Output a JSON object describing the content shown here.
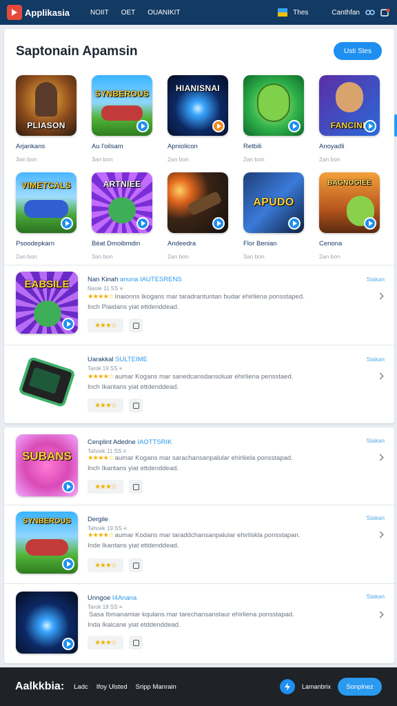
{
  "header": {
    "brand": "Applikasia",
    "nav": [
      "NOIIT",
      "OET",
      "OUANIKIT"
    ],
    "right_label_1": "Thes",
    "right_label_2": "Canthfan"
  },
  "section": {
    "title": "Saptonain Apamsin",
    "see_all_label": "Usti Stes"
  },
  "grid_items": [
    {
      "art_label": "PLIASON",
      "name": "Arjankans",
      "sub": "3an bon",
      "icon": "robot-hero-art"
    },
    {
      "art_label": "SYNBEROUS",
      "name": "Au l'oilsam",
      "sub": "3an bon",
      "icon": "team-battle-art"
    },
    {
      "art_label": "HIANISNAI",
      "name": "Apniolicon",
      "sub": "2an bon",
      "icon": "energy-orb-art"
    },
    {
      "art_label": "",
      "name": "Retbili",
      "sub": "2an bon",
      "icon": "green-ogre-art"
    },
    {
      "art_label": "FANCINE",
      "name": "Anoyadli",
      "sub": "2an bon",
      "icon": "hero-portraits-art"
    },
    {
      "art_label": "VIMETCALS",
      "name": "Psoodepkarn",
      "sub": "2an bon",
      "icon": "crowd-battle-art"
    },
    {
      "art_label": "ARTNIEE",
      "name": "Bèat Dmoibmdin",
      "sub": "3an bon",
      "icon": "purple-creature-art"
    },
    {
      "art_label": "",
      "name": "Andeedra",
      "sub": "2an bon",
      "icon": "cannon-fire-art"
    },
    {
      "art_label": "APUDO",
      "name": "Flor Benian",
      "sub": "3an bon",
      "icon": "mech-blaster-art"
    },
    {
      "art_label": "BAGNOGIEE",
      "name": "Cenona",
      "sub": "2an bon",
      "icon": "ogre-warrior-art"
    }
  ],
  "list_items": [
    {
      "title": "Nan Kinah",
      "title_tag": "anuna IAUTESRENS",
      "meta": "Naoie 11 SS ≡",
      "stars": "★★★★☆",
      "desc_1": "Inaionns Ikogans mar taradrantuntan budar ehirliena ponsstaped.",
      "desc_2": "Inch Piaidans yiat ettdenddead.",
      "rating_chip": "★★★☆",
      "link": "Stakan",
      "art_label": "EABSILE",
      "icon": "club-creature-art"
    },
    {
      "title": "Uarakkal",
      "title_tag": "SULTEIME",
      "meta": "Tarok 19 SS ≡",
      "stars": "★★★★☆",
      "desc_1": "aumar Kogans mar sanedcansdansoluar ehirliena pensstaed.",
      "desc_2": "Inch Ikantans yiat ettdenddead.",
      "rating_chip": "★★★☆",
      "link": "Stakan",
      "art_label": "",
      "icon": "handheld-device-art"
    },
    {
      "title": "Cenplint Adedne",
      "title_tag": "IAOTTSRIK",
      "meta": "Tahoek 11 SS ≡",
      "stars": "★★★★☆",
      "desc_1": "aumar Kogans mar sarachansanpalular ehirliiela ponsstapad.",
      "desc_2": "Inch Ikantans yiat ettdenddead.",
      "rating_chip": "★★★☆",
      "link": "Stakan",
      "art_label": "SUBANS",
      "icon": "comic-title-art"
    },
    {
      "title": "Dergile",
      "title_tag": "",
      "meta": "Tahoek 19 SS ≡",
      "stars": "★★★★☆",
      "desc_1": "aumar Kodans mar taraddchansanpalular ehirliskla ponsstapan.",
      "desc_2": "Inde Ikantans yiat ettdenddead.",
      "rating_chip": "★★★☆",
      "link": "Stakan",
      "art_label": "SYNBEROUS",
      "icon": "team-battle-art"
    },
    {
      "title": "Unngoe",
      "title_tag": "I4Anana",
      "meta": "Tarok 18 SS ≡",
      "stars": "",
      "desc_1": "Sasa Ibmanamiar kqulans mar tarechansanstaur ehirliena ponsstapad.",
      "desc_2": "Inda Ikalcane yiat etddenddead.",
      "rating_chip": "★★★☆",
      "link": "Stakan",
      "art_label": "",
      "icon": "energy-orb-art"
    }
  ],
  "footer": {
    "brand": "Aalkkbia:",
    "links": [
      "Ladc",
      "Ifoy Ulsted",
      "Sripp Manrain"
    ],
    "right_label": "Lamanbrix",
    "button_label": "Sonplnez"
  },
  "colors": {
    "topbar": "#123a63",
    "accent": "#1e8ff0",
    "star": "#f2b100",
    "footer": "#1f2226"
  }
}
